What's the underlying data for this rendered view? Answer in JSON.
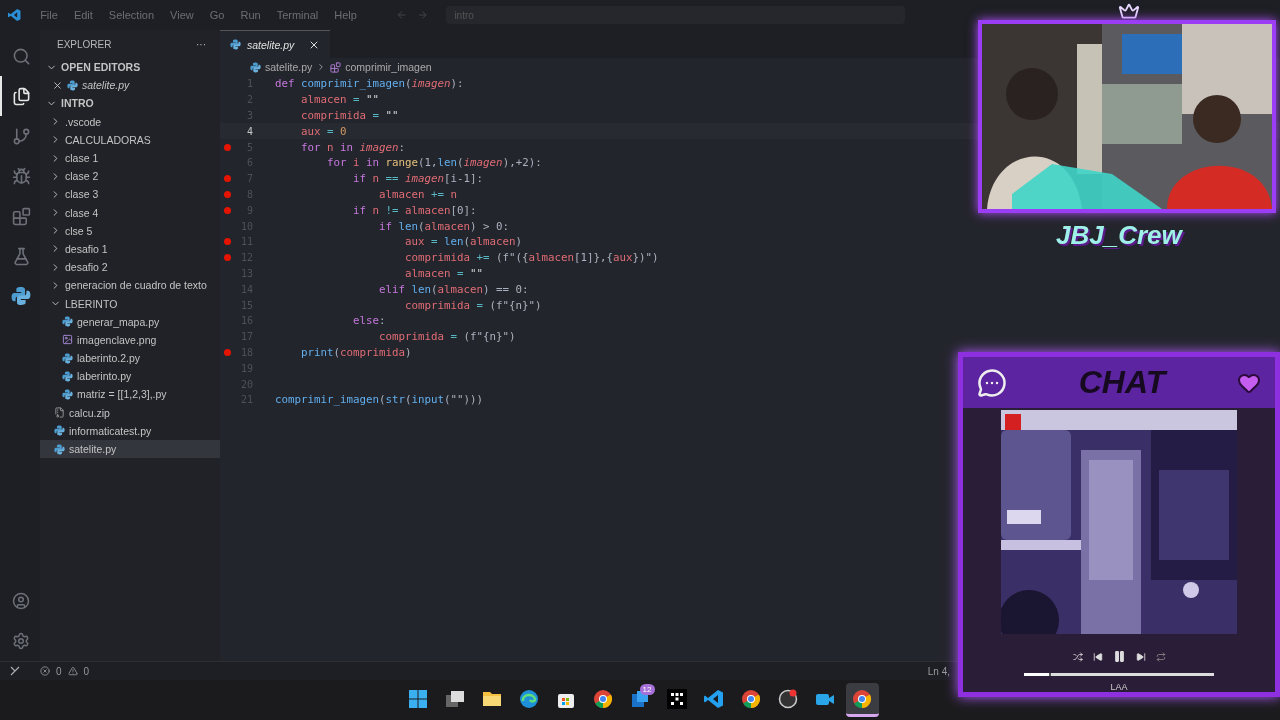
{
  "menu": [
    "File",
    "Edit",
    "Selection",
    "View",
    "Go",
    "Run",
    "Terminal",
    "Help"
  ],
  "search": {
    "value": "intro"
  },
  "activity_bar": {
    "top": [
      {
        "kind": "search",
        "selected": false
      },
      {
        "kind": "files",
        "selected": true
      },
      {
        "kind": "source",
        "selected": false
      },
      {
        "kind": "debug",
        "selected": false
      },
      {
        "kind": "extensions",
        "selected": false
      },
      {
        "kind": "testing",
        "selected": false
      },
      {
        "kind": "python",
        "selected": false
      }
    ],
    "bottom": [
      {
        "kind": "account",
        "selected": false
      },
      {
        "kind": "settings",
        "selected": false
      }
    ]
  },
  "sidebar": {
    "title": "EXPLORER",
    "more": "···",
    "open_editors": {
      "label": "OPEN EDITORS",
      "expanded": true,
      "items": [
        {
          "name": "satelite.py",
          "kind": "py",
          "selected": false
        }
      ]
    },
    "folder": {
      "label": "INTRO",
      "expanded": true,
      "children": [
        {
          "name": ".vscode",
          "kind": "folder",
          "expanded": false,
          "selected": false
        },
        {
          "name": "CALCULADORAS",
          "kind": "folder",
          "expanded": false,
          "selected": false
        },
        {
          "name": "clase 1",
          "kind": "folder",
          "expanded": false,
          "selected": false
        },
        {
          "name": "clase 2",
          "kind": "folder",
          "expanded": false,
          "selected": false
        },
        {
          "name": "clase 3",
          "kind": "folder",
          "expanded": false,
          "selected": false
        },
        {
          "name": "clase 4",
          "kind": "folder",
          "expanded": false,
          "selected": false
        },
        {
          "name": "clse 5",
          "kind": "folder",
          "expanded": false,
          "selected": false
        },
        {
          "name": "desafio 1",
          "kind": "folder",
          "expanded": false,
          "selected": false
        },
        {
          "name": "desafio 2",
          "kind": "folder",
          "expanded": false,
          "selected": false
        },
        {
          "name": "generacion de cuadro de texto",
          "kind": "folder",
          "expanded": false,
          "selected": false
        },
        {
          "name": "LBERINTO",
          "kind": "folder",
          "expanded": true,
          "selected": false,
          "children": [
            {
              "name": "generar_mapa.py",
              "kind": "py",
              "selected": false
            },
            {
              "name": "imagenclave.png",
              "kind": "png",
              "selected": false
            },
            {
              "name": "laberinto.2.py",
              "kind": "py",
              "selected": false
            },
            {
              "name": "laberinto.py",
              "kind": "py",
              "selected": false
            },
            {
              "name": "matriz = [[1,2,3],.py",
              "kind": "py",
              "selected": false
            }
          ]
        },
        {
          "name": "calcu.zip",
          "kind": "zip",
          "selected": false
        },
        {
          "name": "informaticatest.py",
          "kind": "py",
          "selected": false
        },
        {
          "name": "satelite.py",
          "kind": "py",
          "selected": true
        }
      ]
    }
  },
  "editor": {
    "tab": {
      "label": "satelite.py",
      "selected": true
    },
    "breadcrumb": [
      "satelite.py",
      "comprimir_imagen"
    ],
    "lines": [
      {
        "number": "1",
        "breakpoint": false,
        "current": false,
        "tokens": [
          {
            "text": "def",
            "kind": "k"
          },
          {
            "text": " comprimir_imagen",
            "kind": "f"
          },
          {
            "text": "(",
            "kind": "u"
          },
          {
            "text": "imagen",
            "kind": "p"
          },
          {
            "text": "):",
            "kind": "u"
          }
        ]
      },
      {
        "number": "2",
        "breakpoint": false,
        "current": false,
        "tokens": [
          {
            "text": "    almacen",
            "kind": "v"
          },
          {
            "text": " = ",
            "kind": "o"
          },
          {
            "text": "\"\"",
            "kind": "s"
          }
        ]
      },
      {
        "number": "3",
        "breakpoint": false,
        "current": false,
        "tokens": [
          {
            "text": "    comprimida",
            "kind": "v"
          },
          {
            "text": " = ",
            "kind": "o"
          },
          {
            "text": "\"\"",
            "kind": "s"
          }
        ]
      },
      {
        "number": "4",
        "breakpoint": false,
        "current": true,
        "tokens": [
          {
            "text": "    aux",
            "kind": "v"
          },
          {
            "text": " = ",
            "kind": "o"
          },
          {
            "text": "0",
            "kind": "n"
          }
        ]
      },
      {
        "number": "5",
        "breakpoint": true,
        "current": false,
        "tokens": [
          {
            "text": "    for",
            "kind": "k"
          },
          {
            "text": " n",
            "kind": "v"
          },
          {
            "text": " in ",
            "kind": "k"
          },
          {
            "text": "imagen",
            "kind": "p"
          },
          {
            "text": ":",
            "kind": "u"
          }
        ]
      },
      {
        "number": "6",
        "breakpoint": false,
        "current": false,
        "tokens": [
          {
            "text": "        for",
            "kind": "k"
          },
          {
            "text": " i",
            "kind": "v"
          },
          {
            "text": " in ",
            "kind": "k"
          },
          {
            "text": "range",
            "kind": "b"
          },
          {
            "text": "(1,",
            "kind": "u"
          },
          {
            "text": "len",
            "kind": "f"
          },
          {
            "text": "(",
            "kind": "u"
          },
          {
            "text": "imagen",
            "kind": "p"
          },
          {
            "text": "),+2):",
            "kind": "u"
          }
        ]
      },
      {
        "number": "7",
        "breakpoint": true,
        "current": false,
        "tokens": [
          {
            "text": "            if",
            "kind": "k"
          },
          {
            "text": " n ",
            "kind": "v"
          },
          {
            "text": "== ",
            "kind": "o"
          },
          {
            "text": "imagen",
            "kind": "p"
          },
          {
            "text": "[i-1]:",
            "kind": "u"
          }
        ]
      },
      {
        "number": "8",
        "breakpoint": true,
        "current": false,
        "tokens": [
          {
            "text": "                almacen",
            "kind": "v"
          },
          {
            "text": " += ",
            "kind": "o"
          },
          {
            "text": "n",
            "kind": "v"
          }
        ]
      },
      {
        "number": "9",
        "breakpoint": true,
        "current": false,
        "tokens": [
          {
            "text": "            if",
            "kind": "k"
          },
          {
            "text": " n ",
            "kind": "v"
          },
          {
            "text": "!=",
            "kind": "o"
          },
          {
            "text": " almacen",
            "kind": "v"
          },
          {
            "text": "[0]:",
            "kind": "u"
          }
        ]
      },
      {
        "number": "10",
        "breakpoint": false,
        "current": false,
        "tokens": [
          {
            "text": "                if",
            "kind": "k"
          },
          {
            "text": " len",
            "kind": "f"
          },
          {
            "text": "(",
            "kind": "u"
          },
          {
            "text": "almacen",
            "kind": "v"
          },
          {
            "text": ") > 0:",
            "kind": "u"
          }
        ]
      },
      {
        "number": "11",
        "breakpoint": true,
        "current": false,
        "tokens": [
          {
            "text": "                    aux",
            "kind": "v"
          },
          {
            "text": " = ",
            "kind": "o"
          },
          {
            "text": "len",
            "kind": "f"
          },
          {
            "text": "(",
            "kind": "u"
          },
          {
            "text": "almacen",
            "kind": "v"
          },
          {
            "text": ")",
            "kind": "u"
          }
        ]
      },
      {
        "number": "12",
        "breakpoint": true,
        "current": false,
        "tokens": [
          {
            "text": "                    comprimida",
            "kind": "v"
          },
          {
            "text": " += ",
            "kind": "o"
          },
          {
            "text": "(f\"({",
            "kind": "u"
          },
          {
            "text": "almacen",
            "kind": "v"
          },
          {
            "text": "[1]},{",
            "kind": "u"
          },
          {
            "text": "aux",
            "kind": "v"
          },
          {
            "text": "})\")",
            "kind": "u"
          }
        ]
      },
      {
        "number": "13",
        "breakpoint": false,
        "current": false,
        "tokens": [
          {
            "text": "                    almacen",
            "kind": "v"
          },
          {
            "text": " = ",
            "kind": "o"
          },
          {
            "text": "\"\"",
            "kind": "s"
          }
        ]
      },
      {
        "number": "14",
        "breakpoint": false,
        "current": false,
        "tokens": [
          {
            "text": "                elif",
            "kind": "k"
          },
          {
            "text": " len",
            "kind": "f"
          },
          {
            "text": "(",
            "kind": "u"
          },
          {
            "text": "almacen",
            "kind": "v"
          },
          {
            "text": ") == 0:",
            "kind": "u"
          }
        ]
      },
      {
        "number": "15",
        "breakpoint": false,
        "current": false,
        "tokens": [
          {
            "text": "                    comprimida",
            "kind": "v"
          },
          {
            "text": " = ",
            "kind": "o"
          },
          {
            "text": "(f\"{n}\")",
            "kind": "u"
          }
        ]
      },
      {
        "number": "16",
        "breakpoint": false,
        "current": false,
        "tokens": [
          {
            "text": "            else",
            "kind": "k"
          },
          {
            "text": ":",
            "kind": "u"
          }
        ]
      },
      {
        "number": "17",
        "breakpoint": false,
        "current": false,
        "tokens": [
          {
            "text": "                comprimida",
            "kind": "v"
          },
          {
            "text": " = ",
            "kind": "o"
          },
          {
            "text": "(f\"{n}\")",
            "kind": "u"
          }
        ]
      },
      {
        "number": "18",
        "breakpoint": true,
        "current": false,
        "tokens": [
          {
            "text": "    print",
            "kind": "f"
          },
          {
            "text": "(",
            "kind": "u"
          },
          {
            "text": "comprimida",
            "kind": "v"
          },
          {
            "text": ")",
            "kind": "u"
          }
        ]
      },
      {
        "number": "19",
        "breakpoint": false,
        "current": false
      },
      {
        "number": "20",
        "breakpoint": false,
        "current": false
      },
      {
        "number": "21",
        "breakpoint": false,
        "current": false,
        "tokens": [
          {
            "text": "comprimir_imagen",
            "kind": "f"
          },
          {
            "text": "(",
            "kind": "u"
          },
          {
            "text": "str",
            "kind": "f"
          },
          {
            "text": "(",
            "kind": "u"
          },
          {
            "text": "input",
            "kind": "f"
          },
          {
            "text": "(\"\")))",
            "kind": "u"
          }
        ]
      }
    ]
  },
  "status_bar": {
    "errors": "0",
    "warnings": "0",
    "position": "Ln 4,"
  },
  "taskbar": [
    {
      "kind": "start",
      "selected": false
    },
    {
      "kind": "files",
      "selected": false
    },
    {
      "kind": "folder",
      "selected": false
    },
    {
      "kind": "edge",
      "selected": false
    },
    {
      "kind": "store",
      "selected": false
    },
    {
      "kind": "chrome",
      "selected": false
    },
    {
      "kind": "mail",
      "selected": false,
      "badge": "12"
    },
    {
      "kind": "music",
      "selected": false
    },
    {
      "kind": "code",
      "selected": false
    },
    {
      "kind": "chrome",
      "selected": false
    },
    {
      "kind": "record",
      "selected": false
    },
    {
      "kind": "video",
      "selected": false
    },
    {
      "kind": "chrome",
      "selected": true
    }
  ],
  "overlay": {
    "webcam": {
      "caption": "JBJ_Crew"
    },
    "chat": {
      "title": "CHAT",
      "player": {
        "level": 0.13
      },
      "caption": "LAA"
    }
  }
}
